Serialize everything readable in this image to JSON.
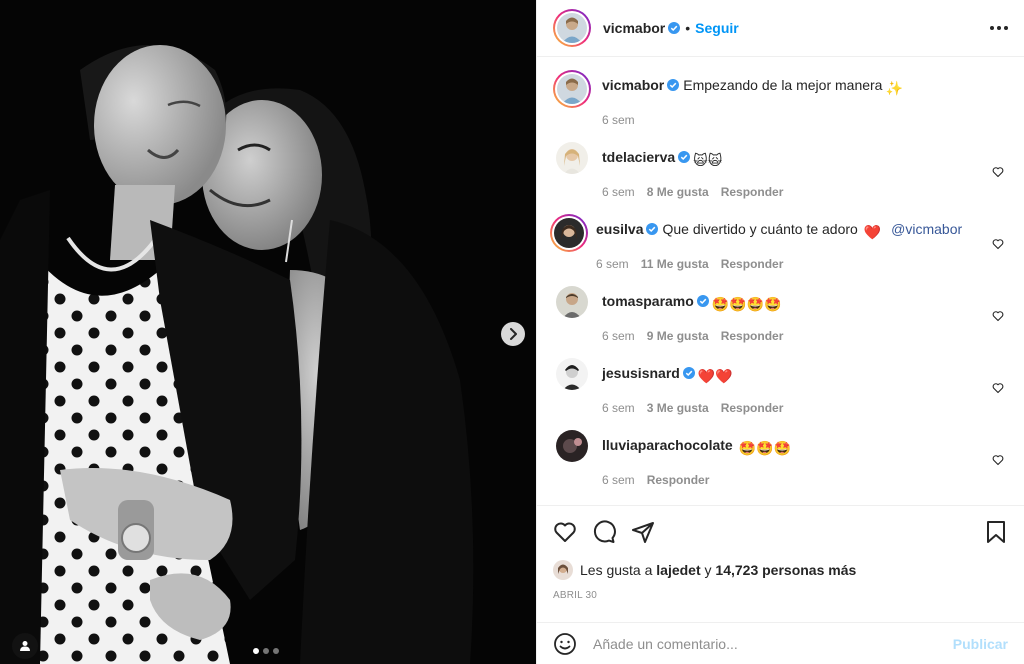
{
  "post": {
    "author": "vicmabor",
    "follow_label": "Seguir",
    "follow_separator": "•",
    "caption": "Empezando de la mejor manera",
    "caption_emoji": "✨",
    "caption_time": "6 sem"
  },
  "comments": [
    {
      "user": "tdelacierva",
      "text": "",
      "emoji": "🙀🙀",
      "time": "6 sem",
      "likes": "8 Me gusta",
      "reply": "Responder"
    },
    {
      "user": "eusilva",
      "text": "Que divertido y cuánto te adoro",
      "emoji": "❤️",
      "mention": "@vicmabor",
      "time": "6 sem",
      "likes": "11 Me gusta",
      "reply": "Responder"
    },
    {
      "user": "tomasparamo",
      "text": "",
      "emoji": "🤩🤩🤩🤩",
      "time": "6 sem",
      "likes": "9 Me gusta",
      "reply": "Responder"
    },
    {
      "user": "jesusisnard",
      "text": "",
      "emoji": "❤️❤️",
      "time": "6 sem",
      "likes": "3 Me gusta",
      "reply": "Responder"
    },
    {
      "user": "lluviaparachocolate",
      "text": "",
      "emoji": "🤩🤩🤩",
      "time": "6 sem",
      "likes": "",
      "reply": "Responder"
    }
  ],
  "likes": {
    "prefix": "Les gusta a",
    "user": "lajedet",
    "joiner": "y",
    "count": "14,723 personas más"
  },
  "date": "ABRIL 30",
  "composer": {
    "placeholder": "Añade un comentario...",
    "publish": "Publicar"
  },
  "icons": {
    "like": "heart-icon",
    "comment": "comment-icon",
    "share": "share-icon",
    "save": "bookmark-icon",
    "emoji": "smiley-icon",
    "more": "more-icon",
    "next": "chevron-right-icon",
    "tags": "user-tag-icon",
    "verified": "verified-badge-icon"
  },
  "colors": {
    "accent": "#0095f6",
    "verified": "#3897f0",
    "muted": "#8e8e8e",
    "publish_disabled": "#b2dffc"
  }
}
